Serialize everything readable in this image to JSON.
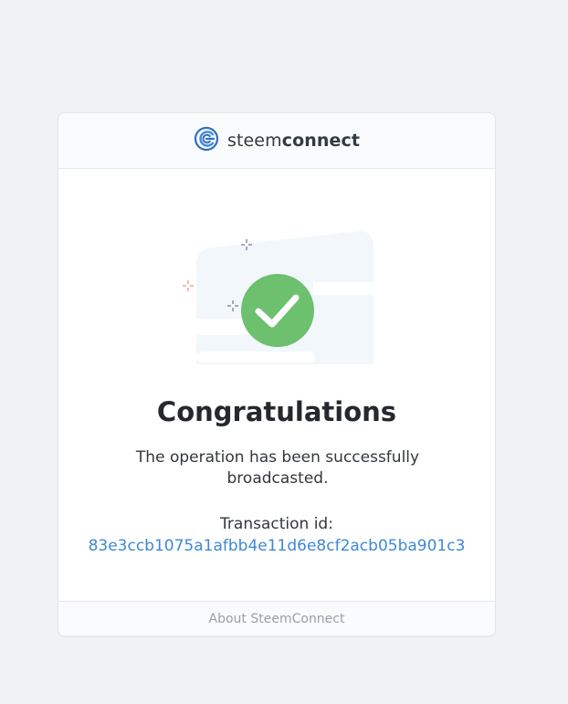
{
  "header": {
    "logo_icon": "steemconnect-logo-icon",
    "brand_light": "steem",
    "brand_bold": "connect"
  },
  "illustration": {
    "icon": "checkmark-circle-icon",
    "accent_green": "#6cc06e"
  },
  "content": {
    "title": "Congratulations",
    "message": "The operation has been successfully broadcasted.",
    "transaction_label": "Transaction id:",
    "transaction_id": "83e3ccb1075a1afbb4e11d6e8cf2acb05ba901c3"
  },
  "footer": {
    "link_label": "About SteemConnect"
  },
  "colors": {
    "link": "#3d88d8",
    "background": "#f1f2f4"
  }
}
